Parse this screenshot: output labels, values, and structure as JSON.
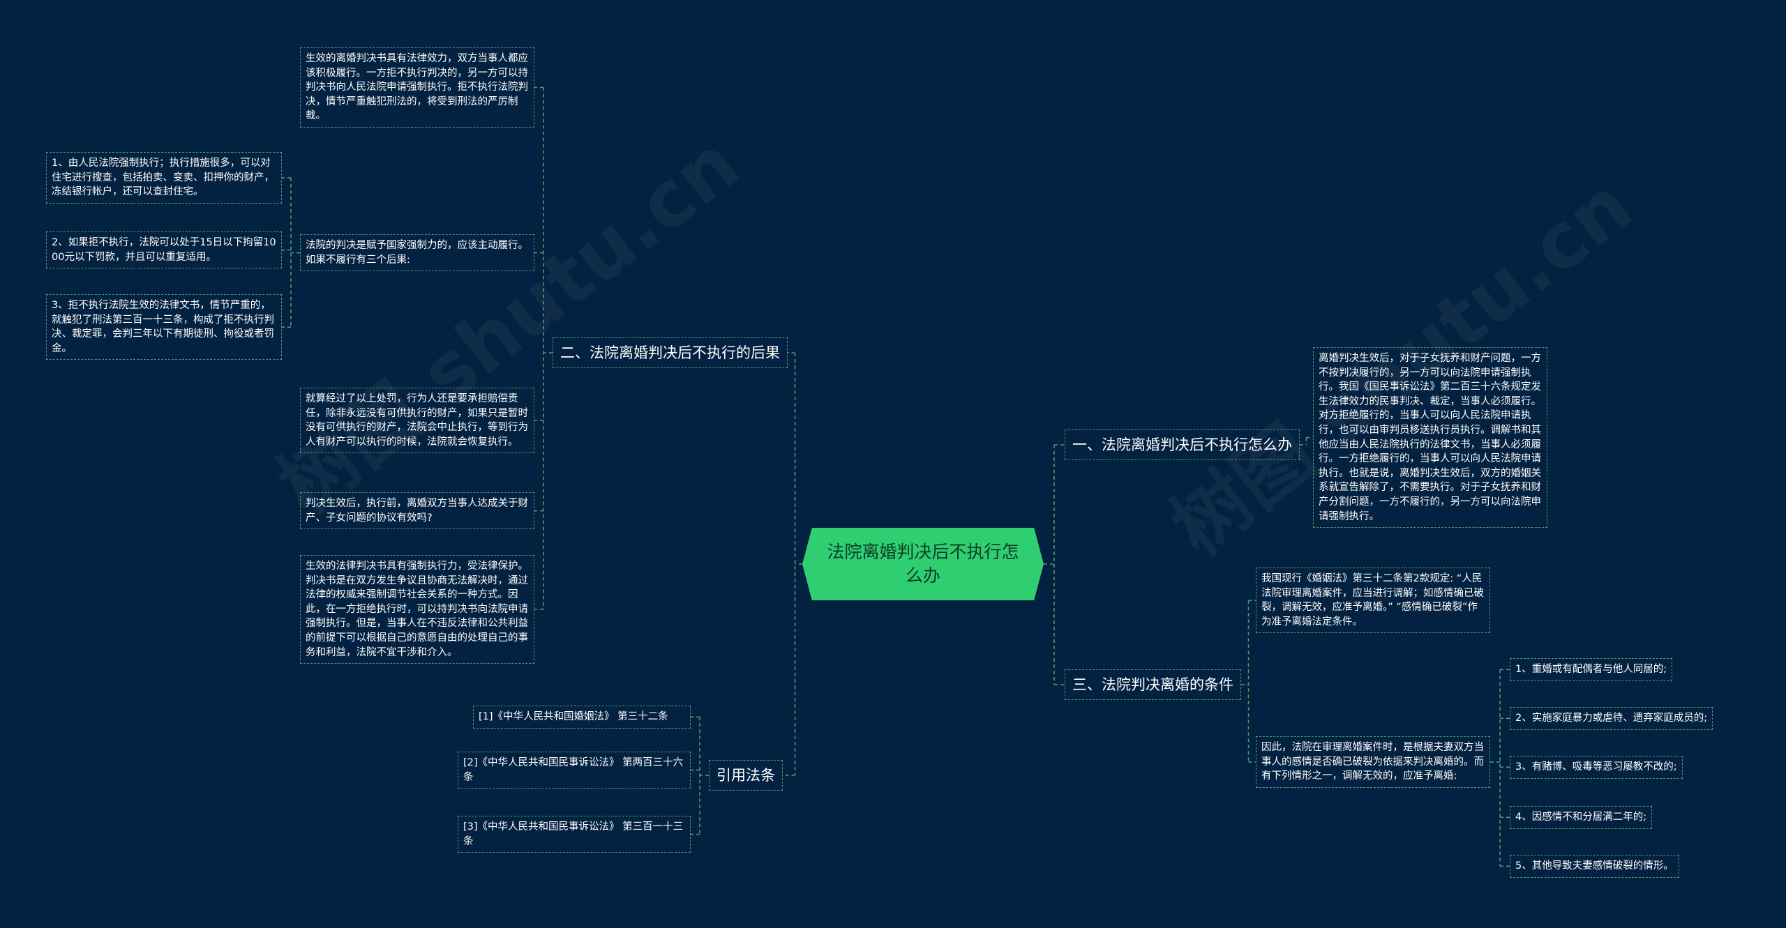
{
  "watermarks": [
    "树图 shutu.cn",
    "树图 shutu.cn"
  ],
  "root": {
    "label": "法院离婚判决后不执行怎么办"
  },
  "branch2": {
    "label": "二、法院离婚判决后不执行的后果",
    "n1": "生效的离婚判决书具有法律效力，双方当事人都应该积极履行。一方拒不执行判决的，另一方可以持判决书向人民法院申请强制执行。拒不执行法院判决，情节严重触犯刑法的，将受到刑法的严厉制裁。",
    "n2": "法院的判决是赋予国家强制力的，应该主动履行。如果不履行有三个后果:",
    "n2a": "1、由人民法院强制执行；执行措施很多，可以对住宅进行搜查，包括拍卖、变卖、扣押你的财产，冻结银行帐户，还可以查封住宅。",
    "n2b": "2、如果拒不执行，法院可以处于15日以下拘留1000元以下罚款，并且可以重复适用。",
    "n2c": "3、拒不执行法院生效的法律文书，情节严重的，就触犯了刑法第三百一十三条，构成了拒不执行判决、裁定罪，会判三年以下有期徒刑、拘役或者罚金。",
    "n3": "就算经过了以上处罚，行为人还是要承担赔偿责任，除非永远没有可供执行的财产，如果只是暂时没有可供执行的财产，法院会中止执行，等到行为人有财产可以执行的时候，法院就会恢复执行。",
    "n4": "判决生效后，执行前，离婚双方当事人达成关于财产、子女问题的协议有效吗?",
    "n5": "生效的法律判决书具有强制执行力，受法律保护。判决书是在双方发生争议且协商无法解决时，通过法律的权威来强制调节社会关系的一种方式。因此，在一方拒绝执行时，可以持判决书向法院申请强制执行。但是，当事人在不违反法律和公共利益的前提下可以根据自己的意愿自由的处理自己的事务和利益，法院不宜干涉和介入。"
  },
  "cite": {
    "label": "引用法条",
    "c1": "[1]《中华人民共和国婚姻法》 第三十二条",
    "c2": "[2]《中华人民共和国民事诉讼法》 第两百三十六条",
    "c3": "[3]《中华人民共和国民事诉讼法》 第三百一十三条"
  },
  "branch1": {
    "label": "一、法院离婚判决后不执行怎么办",
    "n1": "离婚判决生效后，对于子女抚养和财产问题，一方不按判决履行的，另一方可以向法院申请强制执行。我国《国民事诉讼法》第二百三十六条规定发生法律效力的民事判决、裁定，当事人必须履行。对方拒绝履行的，当事人可以向人民法院申请执行，也可以由审判员移送执行员执行。调解书和其他应当由人民法院执行的法律文书，当事人必须履行。一方拒绝履行的，当事人可以向人民法院申请执行。也就是说，离婚判决生效后，双方的婚姻关系就宣告解除了，不需要执行。对于子女抚养和财产分割问题，一方不履行的，另一方可以向法院申请强制执行。"
  },
  "branch3": {
    "label": "三、法院判决离婚的条件",
    "n1": "我国现行《婚姻法》第三十二条第2款规定: “人民法院审理离婚案件，应当进行调解；如感情确已破裂，调解无效，应准予离婚。” “感情确已破裂”作为准予离婚法定条件。",
    "n2": "因此，法院在审理离婚案件时，是根据夫妻双方当事人的感情是否确已破裂为依据来判决离婚的。而有下列情形之一，调解无效的，应准予离婚:",
    "l1": "1、重婚或有配偶者与他人同居的;",
    "l2": "2、实施家庭暴力或虐待、遗弃家庭成员的;",
    "l3": "3、有赌博、吸毒等恶习屡教不改的;",
    "l4": "4、因感情不和分居满二年的;",
    "l5": "5、其他导致夫妻感情破裂的情形。"
  },
  "colors": {
    "background": "#032140",
    "root_fill": "#2fcf71",
    "line": "#4f9a6c",
    "text": "#ffffff"
  }
}
